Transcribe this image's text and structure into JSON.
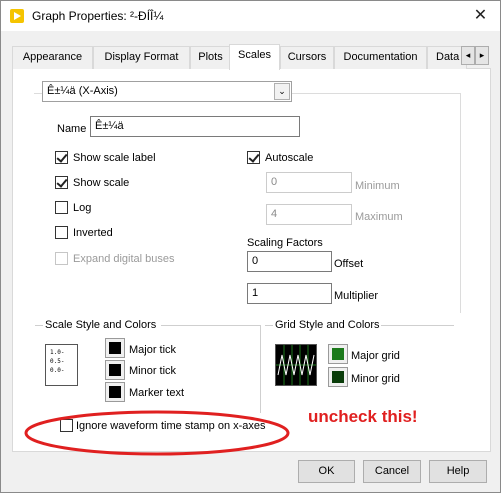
{
  "window": {
    "title": "Graph Properties: ²-ÐÍÎ¼",
    "close_glyph": "✕"
  },
  "tabs": [
    {
      "label": "Appearance"
    },
    {
      "label": "Display Format"
    },
    {
      "label": "Plots"
    },
    {
      "label": "Scales",
      "active": true
    },
    {
      "label": "Cursors"
    },
    {
      "label": "Documentation"
    },
    {
      "label": "Data"
    }
  ],
  "tab_arrows": {
    "left": "◂",
    "right": "▸"
  },
  "axis_select": {
    "value": "Ê±¼ä (X-Axis)",
    "arrow": "⌄"
  },
  "name_field": {
    "label": "Name",
    "value": "Ê±¼ä"
  },
  "left_checks": [
    {
      "label": "Show scale label",
      "checked": true,
      "disabled": false
    },
    {
      "label": "Show scale",
      "checked": true,
      "disabled": false
    },
    {
      "label": "Log",
      "checked": false,
      "disabled": false
    },
    {
      "label": "Inverted",
      "checked": false,
      "disabled": false
    },
    {
      "label": "Expand digital buses",
      "checked": false,
      "disabled": true
    }
  ],
  "autoscale": {
    "label": "Autoscale",
    "checked": true
  },
  "minimum": {
    "value": "0",
    "label": "Minimum"
  },
  "maximum": {
    "value": "4",
    "label": "Maximum"
  },
  "scaling_factors": {
    "title": "Scaling Factors",
    "offset_value": "0",
    "offset_label": "Offset",
    "multiplier_value": "1",
    "multiplier_label": "Multiplier"
  },
  "scale_style": {
    "title": "Scale Style and Colors",
    "icon_lines": [
      "1.0-",
      "0.5-",
      "0.0-"
    ],
    "items": [
      {
        "label": "Major tick",
        "color": "#000000"
      },
      {
        "label": "Minor tick",
        "color": "#000000"
      },
      {
        "label": "Marker text",
        "color": "#000000"
      }
    ]
  },
  "grid_style": {
    "title": "Grid Style and Colors",
    "items": [
      {
        "label": "Major grid",
        "color": "#1c7a1c"
      },
      {
        "label": "Minor grid",
        "color": "#0a3d0a"
      }
    ]
  },
  "ignore_timestamp": {
    "label": "Ignore waveform time stamp on x-axes",
    "checked": false
  },
  "annotation": {
    "text": "uncheck this!",
    "color": "#e02020"
  },
  "buttons": {
    "ok": "OK",
    "cancel": "Cancel",
    "help": "Help"
  }
}
